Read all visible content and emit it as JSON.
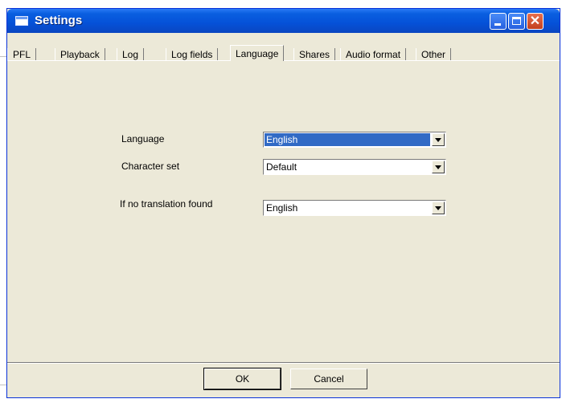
{
  "window": {
    "title": "Settings"
  },
  "tabs": [
    {
      "label": "PFL"
    },
    {
      "label": "Playback"
    },
    {
      "label": "Log"
    },
    {
      "label": "Log fields"
    },
    {
      "label": "Language",
      "active": true
    },
    {
      "label": "Shares"
    },
    {
      "label": "Audio format"
    },
    {
      "label": "Other"
    }
  ],
  "language": {
    "language_label": "Language",
    "language_value": "English",
    "charset_label": "Character set",
    "charset_value": "Default",
    "fallback_label": "If no translation found",
    "fallback_value": "English"
  },
  "buttons": {
    "ok": "OK",
    "cancel": "Cancel"
  },
  "colors": {
    "titlebar": "#0551d8",
    "dialog_bg": "#ece9d8",
    "selection": "#316ac5"
  }
}
